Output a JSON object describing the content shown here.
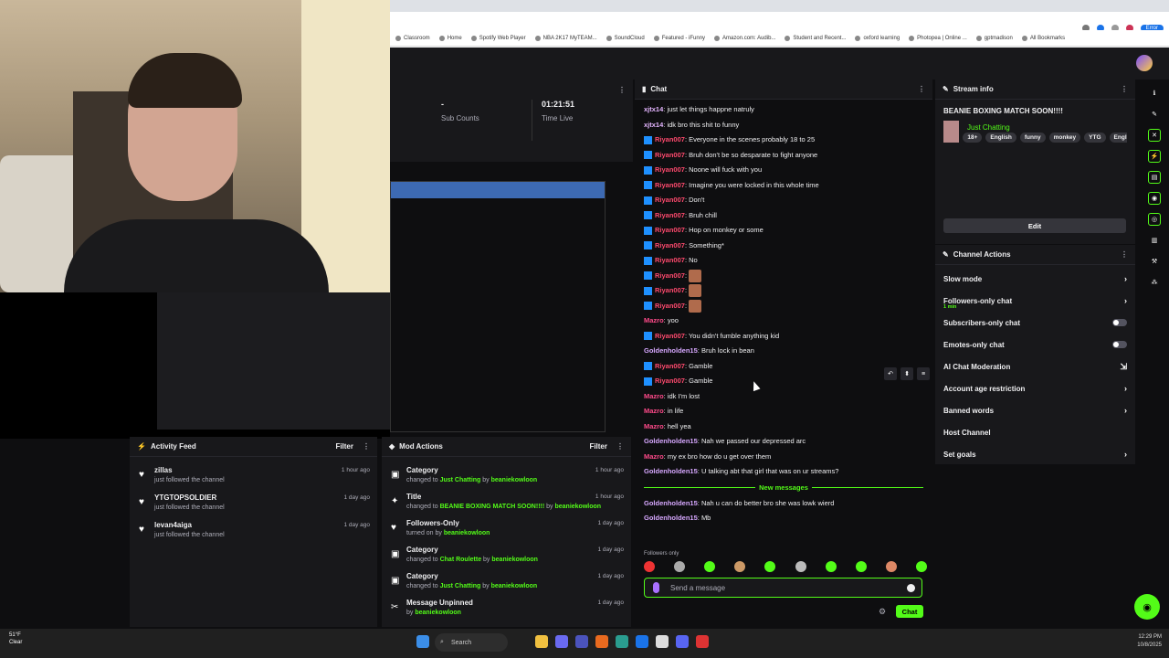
{
  "browser": {
    "bookmarks": [
      "Classroom",
      "Home",
      "Spotify Web Player",
      "NBA 2K17 MyTEAM...",
      "SoundCloud",
      "Featured - iFunny",
      "Amazon.com: Audib...",
      "Student and Recent...",
      "oxford learning",
      "Photopea | Online ...",
      "gptmadison",
      "All Bookmarks"
    ],
    "error_label": "Error"
  },
  "stats": {
    "sub_counts_value": "-",
    "sub_counts_label": "Sub Counts",
    "time_live_value": "01:21:51",
    "time_live_label": "Time Live"
  },
  "activity": {
    "title": "Activity Feed",
    "filter": "Filter",
    "items": [
      {
        "name": "zillas",
        "sub": "just followed the channel",
        "time": "1 hour ago"
      },
      {
        "name": "YTGTOPSOLDIER",
        "sub": "just followed the channel",
        "time": "1 day ago"
      },
      {
        "name": "levan4aiga",
        "sub": "just followed the channel",
        "time": "1 day ago"
      }
    ]
  },
  "mod": {
    "title": "Mod Actions",
    "filter": "Filter",
    "items": [
      {
        "t": "Category",
        "pre": "changed to ",
        "hl": "Just Chatting",
        "mid": " by ",
        "user": "beaniekowloon",
        "time": "1 hour ago"
      },
      {
        "t": "Title",
        "pre": "changed to ",
        "hl": "BEANIE BOXING MATCH SOON!!!!",
        "mid": " by ",
        "user": "beaniekowloon",
        "time": "1 hour ago"
      },
      {
        "t": "Followers-Only",
        "pre": "turned on by ",
        "hl": "",
        "mid": "",
        "user": "beaniekowloon",
        "time": "1 day ago"
      },
      {
        "t": "Category",
        "pre": "changed to ",
        "hl": "Chat Roulette",
        "mid": " by ",
        "user": "beaniekowloon",
        "time": "1 day ago"
      },
      {
        "t": "Category",
        "pre": "changed to ",
        "hl": "Just Chatting",
        "mid": " by ",
        "user": "beaniekowloon",
        "time": "1 day ago"
      },
      {
        "t": "Message Unpinned",
        "pre": "by ",
        "hl": "",
        "mid": "",
        "user": "beaniekowloon",
        "time": "1 day ago"
      }
    ]
  },
  "chat": {
    "title": "Chat",
    "messages": [
      {
        "u": "xjtx14",
        "c": "#e4b5ff",
        "badge": false,
        "t": "just let things happne natruly"
      },
      {
        "u": "xjtx14",
        "c": "#e4b5ff",
        "badge": false,
        "t": "idk bro this shit to funny"
      },
      {
        "u": "Riyan007",
        "c": "#ff4a6e",
        "badge": true,
        "t": "Everyone in the scenes probably 18 to 25"
      },
      {
        "u": "Riyan007",
        "c": "#ff4a6e",
        "badge": true,
        "t": "Bruh don't be so desparate to fight anyone"
      },
      {
        "u": "Riyan007",
        "c": "#ff4a6e",
        "badge": true,
        "t": "Noone will fuck with you"
      },
      {
        "u": "Riyan007",
        "c": "#ff4a6e",
        "badge": true,
        "t": "Imagine you were locked in this whole time"
      },
      {
        "u": "Riyan007",
        "c": "#ff4a6e",
        "badge": true,
        "t": "Don't"
      },
      {
        "u": "Riyan007",
        "c": "#ff4a6e",
        "badge": true,
        "t": "Bruh chill"
      },
      {
        "u": "Riyan007",
        "c": "#ff4a6e",
        "badge": true,
        "t": "Hop on monkey or some"
      },
      {
        "u": "Riyan007",
        "c": "#ff4a6e",
        "badge": true,
        "t": "Something*"
      },
      {
        "u": "Riyan007",
        "c": "#ff4a6e",
        "badge": true,
        "t": "No"
      },
      {
        "u": "Riyan007",
        "c": "#ff4a6e",
        "badge": true,
        "t": "",
        "emote": true
      },
      {
        "u": "Riyan007",
        "c": "#ff4a6e",
        "badge": true,
        "t": "",
        "emote": true
      },
      {
        "u": "Riyan007",
        "c": "#ff4a6e",
        "badge": true,
        "t": "",
        "emote": true
      },
      {
        "u": "Mazro",
        "c": "#ff4a8a",
        "badge": false,
        "t": "yoo"
      },
      {
        "u": "Riyan007",
        "c": "#ff4a6e",
        "badge": true,
        "t": "You didn't fumble anything kid"
      },
      {
        "u": "Goldenholden15",
        "c": "#d7a8ff",
        "badge": false,
        "t": "Bruh lock in bean"
      },
      {
        "u": "Riyan007",
        "c": "#ff4a6e",
        "badge": true,
        "t": "Gamble"
      },
      {
        "u": "Riyan007",
        "c": "#ff4a6e",
        "badge": true,
        "t": "Gamble"
      },
      {
        "u": "Mazro",
        "c": "#ff4a8a",
        "badge": false,
        "t": "idk I'm lost"
      },
      {
        "u": "Mazro",
        "c": "#ff4a8a",
        "badge": false,
        "t": "in life"
      },
      {
        "u": "Mazro",
        "c": "#ff4a8a",
        "badge": false,
        "t": "hell yea"
      },
      {
        "u": "Goldenholden15",
        "c": "#d7a8ff",
        "badge": false,
        "t": "Nah we passed our depressed arc"
      },
      {
        "u": "Mazro",
        "c": "#ff4a8a",
        "badge": false,
        "t": "my ex bro how do u get over them"
      },
      {
        "u": "Goldenholden15",
        "c": "#d7a8ff",
        "badge": false,
        "t": "U talking abt that girl that was on ur streams?"
      }
    ],
    "new_messages_label": "New messages",
    "new_messages": [
      {
        "u": "Goldenholden15",
        "c": "#d7a8ff",
        "badge": false,
        "t": "Nah u can do better bro she was lowk wierd"
      },
      {
        "u": "Goldenholden15",
        "c": "#d7a8ff",
        "badge": false,
        "t": "Mb"
      }
    ],
    "followers_only": "Followers only",
    "input_placeholder": "Send a message",
    "send_label": "Chat"
  },
  "stream_info": {
    "header": "Stream info",
    "title": "BEANIE BOXING MATCH SOON!!!!",
    "category": "Just Chatting",
    "tags": [
      "18+",
      "English",
      "funny",
      "monkey",
      "YTG",
      "Engli"
    ],
    "edit_label": "Edit"
  },
  "channel_actions": {
    "header": "Channel Actions",
    "items": [
      {
        "label": "Slow mode",
        "kind": "arrow"
      },
      {
        "label": "Followers-only chat",
        "kind": "arrow",
        "sub": "1 min"
      },
      {
        "label": "Subscribers-only chat",
        "kind": "toggle"
      },
      {
        "label": "Emotes-only chat",
        "kind": "toggle"
      },
      {
        "label": "AI Chat Moderation",
        "kind": "ext"
      },
      {
        "label": "Account age restriction",
        "kind": "arrow"
      },
      {
        "label": "Banned words",
        "kind": "arrow"
      },
      {
        "label": "Host Channel",
        "kind": "none"
      },
      {
        "label": "Set goals",
        "kind": "arrow"
      }
    ]
  },
  "taskbar": {
    "weather_temp": "51°F",
    "weather_desc": "Clear",
    "search": "Search",
    "time": "12:29 PM",
    "date": "10/8/2025"
  },
  "colors": {
    "accent": "#53fc18",
    "panel": "#18181b",
    "bg": "#0e0e10"
  }
}
